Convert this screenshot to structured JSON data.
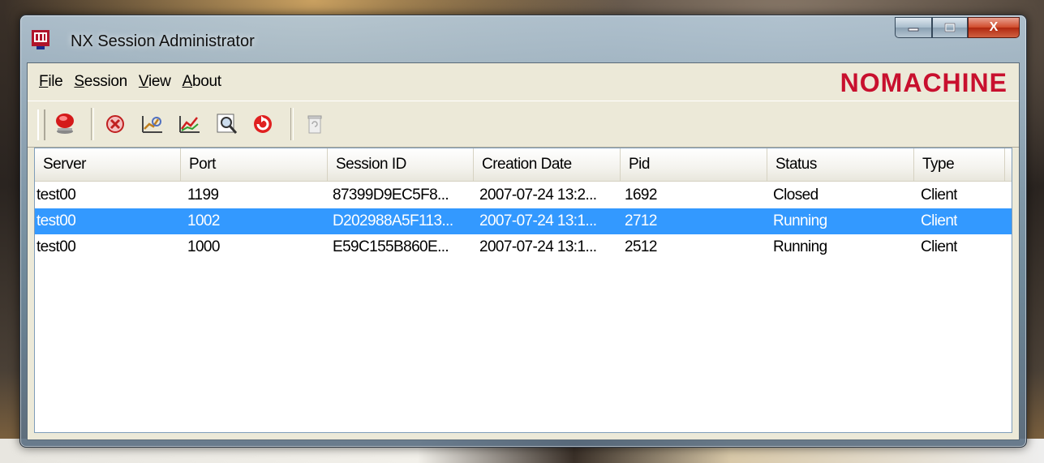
{
  "window": {
    "title": "NX Session Administrator",
    "close_glyph": "X"
  },
  "menu": {
    "file": {
      "accel": "F",
      "rest": "ile"
    },
    "session": {
      "accel": "S",
      "rest": "ession"
    },
    "view": {
      "accel": "V",
      "rest": "iew"
    },
    "about": {
      "accel": "A",
      "rest": "bout"
    }
  },
  "brand": "NOMACHINE",
  "toolbar": {
    "icons": [
      "new-session-icon",
      "terminate-icon",
      "stats-icon",
      "graph-icon",
      "search-icon",
      "refresh-icon",
      "trash-icon"
    ]
  },
  "table": {
    "columns": [
      "Server",
      "Port",
      "Session ID",
      "Creation Date",
      "Pid",
      "Status",
      "Type"
    ],
    "rows": [
      {
        "server": "test00",
        "port": "1199",
        "session_id": "87399D9EC5F8...",
        "creation_date": "2007-07-24 13:2...",
        "pid": "1692",
        "status": "Closed",
        "type": "Client",
        "selected": false
      },
      {
        "server": "test00",
        "port": "1002",
        "session_id": "D202988A5F113...",
        "creation_date": "2007-07-24 13:1...",
        "pid": "2712",
        "status": "Running",
        "type": "Client",
        "selected": true
      },
      {
        "server": "test00",
        "port": "1000",
        "session_id": "E59C155B860E...",
        "creation_date": "2007-07-24 13:1...",
        "pid": "2512",
        "status": "Running",
        "type": "Client",
        "selected": false
      }
    ]
  },
  "colors": {
    "brand": "#c8102e",
    "selection": "#3399ff",
    "chrome": "#ece9d8"
  }
}
